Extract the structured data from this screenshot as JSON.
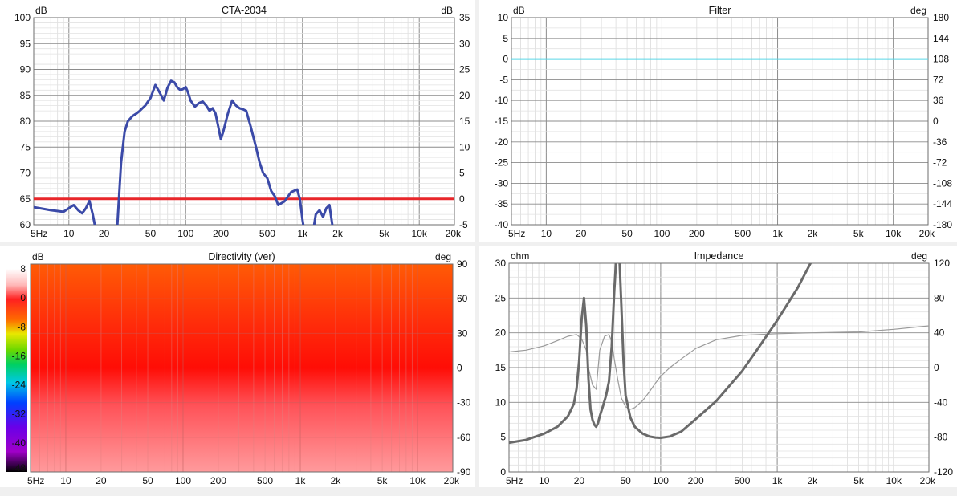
{
  "xticks": [
    "5Hz",
    "10",
    "20",
    "50",
    "100",
    "200",
    "500",
    "1k",
    "2k",
    "5k",
    "10k",
    "20k"
  ],
  "xtick_values": [
    5,
    10,
    20,
    50,
    100,
    200,
    500,
    1000,
    2000,
    5000,
    10000,
    20000
  ],
  "colors": {
    "panel_bg": "#ffffff",
    "spl_curve": "#3b4aa8",
    "reference_line": "#e8262a",
    "filter_curve": "#5ad6e6",
    "impedance_mag": "#6a6a6a",
    "impedance_phase": "#9a9a9a"
  },
  "chart_data": [
    {
      "type": "line",
      "title": "CTA-2034",
      "left_unit": "dB",
      "right_unit": "dB",
      "xlim": [
        5,
        20000
      ],
      "ylim": [
        60,
        100
      ],
      "yticks": [
        "100",
        "95",
        "90",
        "85",
        "80",
        "75",
        "70",
        "65",
        "60"
      ],
      "y2lim": [
        -5,
        35
      ],
      "y2ticks": [
        "35",
        "30",
        "25",
        "20",
        "15",
        "10",
        "5",
        "0",
        "-5"
      ],
      "series": [
        {
          "color": "#3b4aa8",
          "x": [
            5,
            7,
            9,
            10,
            11,
            12,
            13,
            14,
            15,
            16,
            17
          ],
          "y": [
            63.4,
            62.8,
            62.5,
            63.2,
            63.8,
            62.8,
            62.2,
            63.2,
            64.6,
            62.0,
            59.0
          ]
        },
        {
          "color": "#3b4aa8",
          "x": [
            26,
            27,
            28,
            30,
            32,
            35,
            38,
            40,
            45,
            50,
            55,
            60,
            65,
            70,
            75,
            80,
            85,
            90,
            95,
            100,
            105,
            110,
            120,
            130,
            140,
            150,
            160,
            170,
            180,
            190,
            200,
            210,
            230,
            250,
            270,
            290,
            310,
            330,
            360,
            400,
            430,
            460,
            500,
            540,
            580,
            620,
            700,
            800,
            900,
            950,
            1000,
            1050
          ],
          "y": [
            60,
            66,
            72,
            78,
            80,
            81,
            81.5,
            81.9,
            83,
            84.5,
            87,
            85.5,
            84,
            86.5,
            87.8,
            87.5,
            86.5,
            86.0,
            86.2,
            86.6,
            85.5,
            84,
            82.8,
            83.5,
            83.8,
            83,
            82,
            82.5,
            81.5,
            79,
            76.5,
            78,
            81.5,
            84,
            83,
            82.5,
            82.3,
            82,
            79,
            75,
            72,
            70,
            69,
            66.5,
            65.5,
            63.8,
            64.5,
            66.3,
            66.8,
            65,
            61,
            58
          ]
        },
        {
          "color": "#3b4aa8",
          "x": [
            1250,
            1300,
            1400,
            1500,
            1600,
            1700,
            1800
          ],
          "y": [
            59.5,
            62.0,
            62.8,
            61.5,
            63.2,
            63.8,
            60.0
          ]
        }
      ],
      "hlines": [
        {
          "value": 0,
          "axis": "right",
          "color": "#e8262a"
        }
      ]
    },
    {
      "type": "line",
      "title": "Filter",
      "left_unit": "dB",
      "right_unit": "deg",
      "xlim": [
        5,
        20000
      ],
      "ylim": [
        -40,
        10
      ],
      "yticks": [
        "10",
        "5",
        "0",
        "-5",
        "-10",
        "-15",
        "-20",
        "-25",
        "-30",
        "-35",
        "-40"
      ],
      "y2lim": [
        -180,
        180
      ],
      "y2ticks": [
        "180",
        "144",
        "108",
        "72",
        "36",
        "0",
        "-36",
        "-72",
        "-108",
        "-144",
        "-180"
      ],
      "series": [
        {
          "color": "#5ad6e6",
          "x": [
            5,
            20000
          ],
          "y": [
            0,
            0
          ]
        }
      ]
    },
    {
      "type": "heatmap",
      "title": "Directivity (ver)",
      "left_unit": "dB",
      "right_unit": "deg",
      "xlim": [
        5,
        20000
      ],
      "ylim": [
        -90,
        90
      ],
      "y2ticks": [
        "90",
        "60",
        "30",
        "0",
        "-30",
        "-60",
        "-90"
      ],
      "colorbar_ticks": [
        "8",
        "0",
        "-8",
        "-16",
        "-24",
        "-32",
        "-40",
        "-48"
      ],
      "colorbar_range": [
        -48,
        8
      ]
    },
    {
      "type": "line",
      "title": "Impedance",
      "left_unit": "ohm",
      "right_unit": "deg",
      "xlim": [
        5,
        20000
      ],
      "ylim": [
        0,
        30
      ],
      "yticks": [
        "30",
        "25",
        "20",
        "15",
        "10",
        "5",
        "0"
      ],
      "y2lim": [
        -120,
        120
      ],
      "y2ticks": [
        "120",
        "80",
        "40",
        "0",
        "-40",
        "-80",
        "-120"
      ],
      "series": [
        {
          "color": "#9a9a9a",
          "axis": "right",
          "x": [
            5,
            7,
            10,
            13,
            16,
            19,
            21,
            23,
            24,
            26,
            28,
            30,
            33,
            36,
            38,
            40,
            43,
            46,
            50,
            55,
            60,
            70,
            80,
            90,
            100,
            120,
            150,
            200,
            300,
            500,
            700,
            1000,
            2000,
            5000,
            10000,
            20000
          ],
          "y": [
            18,
            20,
            25,
            31,
            36,
            38,
            33,
            20,
            0,
            -20,
            -25,
            20,
            36,
            38,
            30,
            10,
            -15,
            -35,
            -45,
            -48,
            -46,
            -38,
            -28,
            -18,
            -10,
            0,
            10,
            22,
            32,
            37,
            38,
            39,
            40,
            41,
            44,
            48
          ]
        },
        {
          "color": "#6a6a6a",
          "x": [
            5,
            7,
            10,
            13,
            16,
            18,
            19,
            20,
            21,
            22,
            23,
            24,
            25,
            26,
            27,
            28,
            29,
            30,
            32,
            34,
            36,
            38,
            40,
            42,
            44,
            46,
            48,
            50,
            55,
            60,
            70,
            80,
            90,
            100,
            120,
            150,
            200,
            300,
            500,
            700,
            1000,
            1500,
            2000
          ],
          "y": [
            4.2,
            4.6,
            5.5,
            6.5,
            8.0,
            9.8,
            12.0,
            16.0,
            22.0,
            25.0,
            21.0,
            13.5,
            9.0,
            7.5,
            6.8,
            6.5,
            7.0,
            8.0,
            9.5,
            11.0,
            13.0,
            18.0,
            26.0,
            32.0,
            32.0,
            24.0,
            16.0,
            11.0,
            7.8,
            6.5,
            5.5,
            5.1,
            4.95,
            4.9,
            5.1,
            5.8,
            7.6,
            10.2,
            14.5,
            18.0,
            21.8,
            26.5,
            30.5
          ]
        }
      ]
    }
  ]
}
